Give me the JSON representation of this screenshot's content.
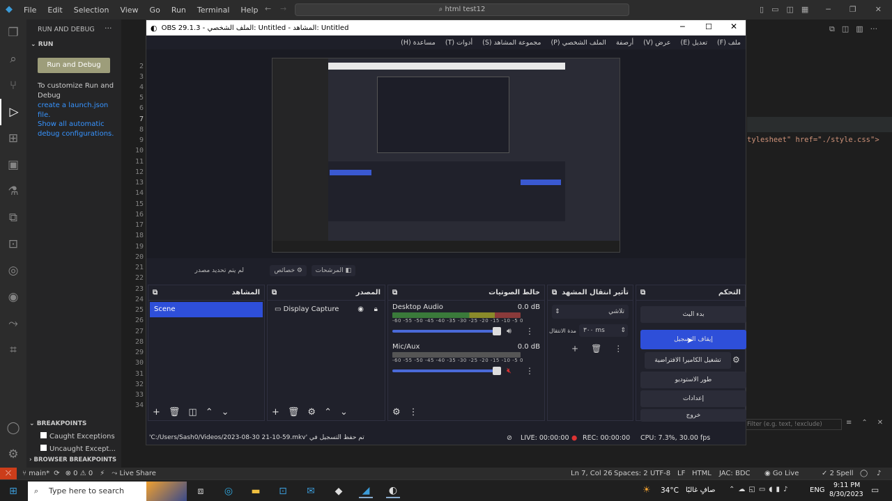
{
  "vscode": {
    "menu": [
      "File",
      "Edit",
      "Selection",
      "View",
      "Go",
      "Run",
      "Terminal",
      "Help"
    ],
    "search": "html test12",
    "sidebar": {
      "header": "RUN AND DEBUG",
      "section": "RUN",
      "run_button": "Run and Debug",
      "customize_text": "To customize Run and Debug",
      "create_link": "create a launch.json file.",
      "show_all": "Show all automatic debug configurations.",
      "breakpoints_header": "BREAKPOINTS",
      "bp1": "Caught Exceptions",
      "bp2": "Uncaught Except...",
      "browser_bp": "BROWSER BREAKPOINTS"
    },
    "code_line": "tylesheet\" href=\"./style.css\">",
    "filter_placeholder": "Filter (e.g. text, !exclude)",
    "status": {
      "branch": "main*",
      "errors": "0",
      "warnings": "0",
      "live_share": "Live Share",
      "ln_col": "Ln 7, Col 26",
      "spaces": "Spaces: 2",
      "encoding": "UTF-8",
      "eol": "LF",
      "lang": "HTML",
      "jac": "JAC: BDC",
      "go_live": "Go Live",
      "spell": "2 Spell"
    }
  },
  "obs": {
    "title": "OBS 29.1.3 - الملف الشخصي: Untitled - المشاهد: Untitled",
    "menu": [
      "ملف (F)",
      "تعديل (E)",
      "عرض (V)",
      "أرصفة",
      "الملف الشخصي (P)",
      "مجموعة المشاهد (S)",
      "أدوات (T)",
      "مساعدة (H)"
    ],
    "source_bar": {
      "no_source": "لم يتم تحديد مصدر",
      "properties": "خصائص",
      "filters": "المرشحات"
    },
    "scenes": {
      "title": "المشاهد",
      "items": [
        "Scene"
      ]
    },
    "sources": {
      "title": "المصدر",
      "items": [
        "Display Capture"
      ]
    },
    "mixer": {
      "title": "خالط الصوتيات",
      "channels": [
        {
          "name": "Desktop Audio",
          "db": "0.0 dB"
        },
        {
          "name": "Mic/Aux",
          "db": "0.0 dB"
        }
      ],
      "ticks": "-60 -55 -50 -45 -40 -35 -30 -25 -20 -15 -10 -5 0"
    },
    "transitions": {
      "title": "تأثير انتقال المشهد",
      "type": "تلاشي",
      "duration_label": "مدة الانتقال",
      "duration": "٣٠٠ ms"
    },
    "controls": {
      "title": "التحكم",
      "buttons": [
        "بدء البث",
        "إيقاف التسجيل",
        "تشغيل الكاميرا الافتراضية",
        "طور الاستوديو",
        "إعدادات",
        "خروج"
      ]
    },
    "status": {
      "saved": "تم حفظ التسجيل في 'C:/Users/Sash0/Videos/2023-08-30 21-10-59.mkv'",
      "live": "LIVE: 00:00:00",
      "rec": "REC: 00:00:00",
      "cpu": "CPU: 7.3%, 30.00 fps"
    }
  },
  "taskbar": {
    "search": "Type here to search",
    "weather_temp": "34°C",
    "weather_desc": "صافٍ غالبًا",
    "lang": "ENG",
    "time": "9:11 PM",
    "date": "8/30/2023"
  }
}
